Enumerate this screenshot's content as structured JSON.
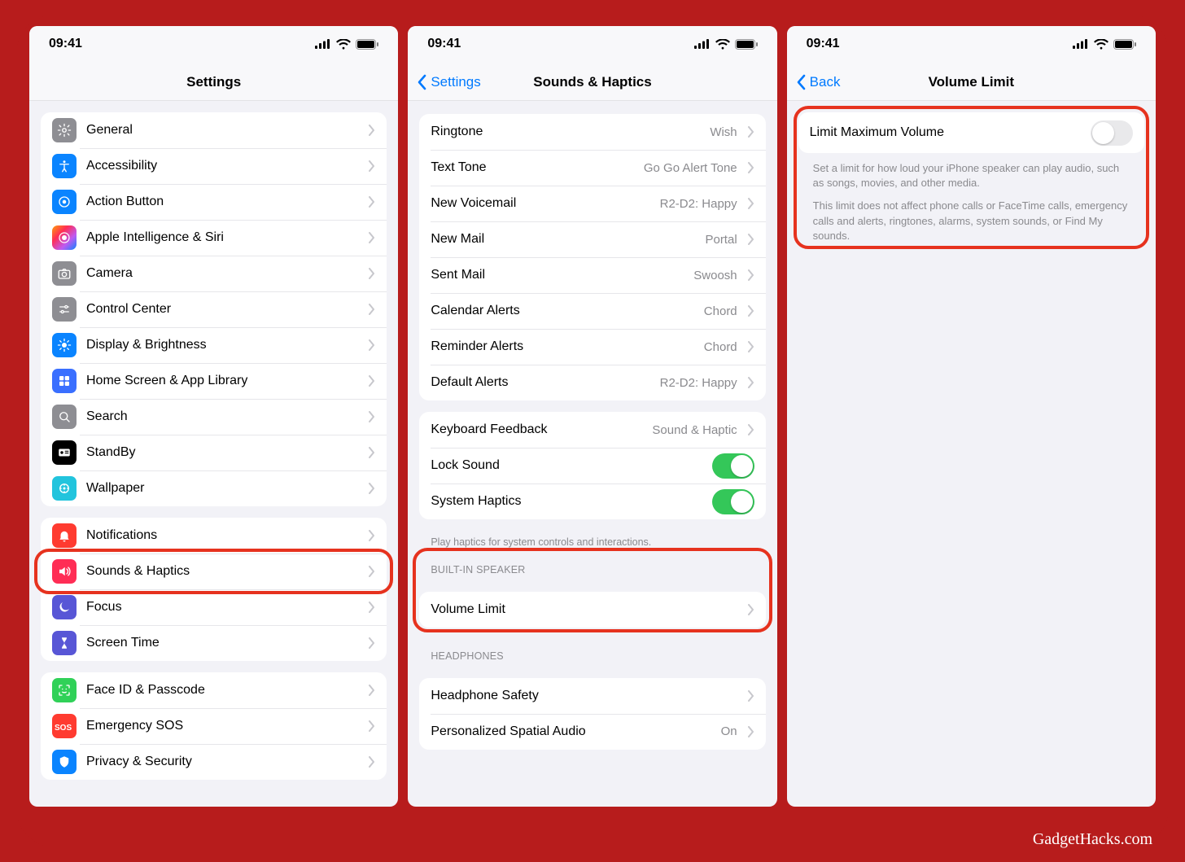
{
  "statusTime": "09:41",
  "watermark": "GadgetHacks.com",
  "phone1": {
    "title": "Settings",
    "groups": [
      [
        {
          "label": "General",
          "icon": "gear",
          "bg": "#8e8e93"
        },
        {
          "label": "Accessibility",
          "icon": "accessibility",
          "bg": "#0a84ff"
        },
        {
          "label": "Action Button",
          "icon": "action",
          "bg": "#0a84ff"
        },
        {
          "label": "Apple Intelligence & Siri",
          "icon": "siri",
          "bg": "linear-gradient(135deg,#ff9f0a,#ff2d55,#bf5af2,#0a84ff)"
        },
        {
          "label": "Camera",
          "icon": "camera",
          "bg": "#8e8e93"
        },
        {
          "label": "Control Center",
          "icon": "control",
          "bg": "#8e8e93"
        },
        {
          "label": "Display & Brightness",
          "icon": "brightness",
          "bg": "#0a84ff"
        },
        {
          "label": "Home Screen & App Library",
          "icon": "home",
          "bg": "#3a6fff"
        },
        {
          "label": "Search",
          "icon": "search",
          "bg": "#8e8e93"
        },
        {
          "label": "StandBy",
          "icon": "standby",
          "bg": "#000000"
        },
        {
          "label": "Wallpaper",
          "icon": "wallpaper",
          "bg": "#22c4dd"
        }
      ],
      [
        {
          "label": "Notifications",
          "icon": "bell",
          "bg": "#ff3b30"
        },
        {
          "label": "Sounds & Haptics",
          "icon": "sound",
          "bg": "#ff2d55",
          "highlight": true
        },
        {
          "label": "Focus",
          "icon": "moon",
          "bg": "#5856d6"
        },
        {
          "label": "Screen Time",
          "icon": "hourglass",
          "bg": "#5856d6"
        }
      ],
      [
        {
          "label": "Face ID & Passcode",
          "icon": "faceid",
          "bg": "#30d158"
        },
        {
          "label": "Emergency SOS",
          "icon": "sos",
          "bg": "#ff3b30"
        },
        {
          "label": "Privacy & Security",
          "icon": "privacy",
          "bg": "#0a84ff",
          "cut": true
        }
      ]
    ]
  },
  "phone2": {
    "back": "Settings",
    "title": "Sounds & Haptics",
    "groupA": [
      {
        "label": "Ringtone",
        "detail": "Wish"
      },
      {
        "label": "Text Tone",
        "detail": "Go Go Alert Tone"
      },
      {
        "label": "New Voicemail",
        "detail": "R2-D2: Happy"
      },
      {
        "label": "New Mail",
        "detail": "Portal"
      },
      {
        "label": "Sent Mail",
        "detail": "Swoosh"
      },
      {
        "label": "Calendar Alerts",
        "detail": "Chord"
      },
      {
        "label": "Reminder Alerts",
        "detail": "Chord"
      },
      {
        "label": "Default Alerts",
        "detail": "R2-D2: Happy"
      }
    ],
    "groupB": [
      {
        "label": "Keyboard Feedback",
        "detail": "Sound & Haptic",
        "type": "nav"
      },
      {
        "label": "Lock Sound",
        "type": "toggle",
        "on": true
      },
      {
        "label": "System Haptics",
        "type": "toggle",
        "on": true
      }
    ],
    "groupBFooter": "Play haptics for system controls and interactions.",
    "sectC": "BUILT-IN SPEAKER",
    "groupC": [
      {
        "label": "Volume Limit",
        "type": "nav"
      }
    ],
    "sectD": "HEADPHONES",
    "groupD": [
      {
        "label": "Headphone Safety",
        "type": "nav"
      },
      {
        "label": "Personalized Spatial Audio",
        "detail": "On",
        "type": "nav"
      }
    ]
  },
  "phone3": {
    "back": "Back",
    "title": "Volume Limit",
    "toggleLabel": "Limit Maximum Volume",
    "toggleOn": false,
    "explain1": "Set a limit for how loud your iPhone speaker can play audio, such as songs, movies, and other media.",
    "explain2": "This limit does not affect phone calls or FaceTime calls, emergency calls and alerts, ringtones, alarms, system sounds, or Find My sounds."
  }
}
